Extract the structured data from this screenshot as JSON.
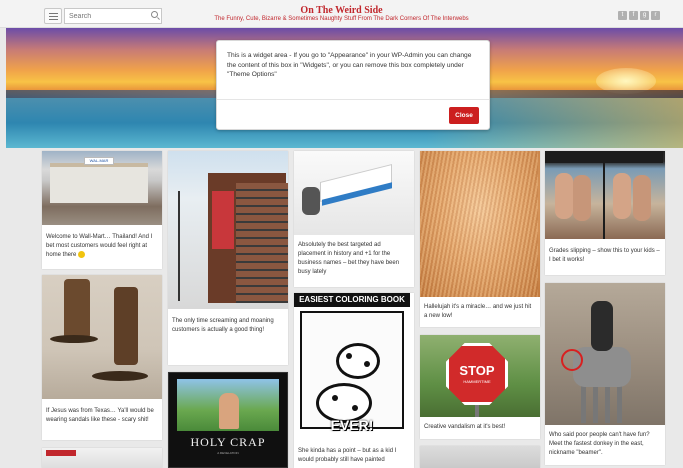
{
  "header": {
    "search_placeholder": "Search",
    "site_title": "On The Weird Side",
    "tagline": "The Funny, Cute, Bizarre & Sometimes Naughty Stuff From The Dark Corners Of The Interwebs",
    "social_icons": [
      "twitter-icon",
      "facebook-icon",
      "google-plus-icon",
      "rss-icon"
    ],
    "social_glyphs": [
      "t",
      "f",
      "g",
      "r"
    ]
  },
  "widget": {
    "text": "This is a widget area - If you go to \"Appearance\" in your WP-Admin you can change the content of this box in \"Widgets\", or you can remove this box completely under \"Theme Options\"",
    "close_label": "Close"
  },
  "cards": {
    "walmart": {
      "caption": "Welcome to Wall-Mart… Thailand! And I bet most customers would feel right at home there",
      "sign": "WAL-MAR"
    },
    "boots": {
      "caption": "If Jesus was from Texas… Ya'll would be wearing sandals like these - scary shit!"
    },
    "building": {
      "caption": "The only time screaming and moaning customers is actually a good thing!"
    },
    "holycrap": {
      "title": "HOLY CRAP",
      "sub": "A REVELATION"
    },
    "ad": {
      "caption": "Absolutely the best targeted ad placement in history and +1 for the business names – bet they have been busy lately"
    },
    "coloring": {
      "header": "EASIEST COLORING BOOK",
      "ever": "EVER!",
      "caption": "She kinda has a point – but as a kid I would probably still have painted"
    },
    "hallelujah": {
      "caption": "Hallelujah it's a miracle… and we just hit a new low!"
    },
    "stop": {
      "sign": "STOP",
      "sub": "HAMMERTIME",
      "caption": "Creative vandalism at it's best!"
    },
    "grades": {
      "caption": "Grades slipping – show this to your kids – I bet it works!"
    },
    "donkey": {
      "caption": "Who said poor people can't have fun? Meet the fastest donkey in the east, nickname \"beamer\"."
    }
  },
  "colors": {
    "brand_red": "#c1272d",
    "close_button": "#cc1f1f",
    "background": "#e9e9e9"
  }
}
